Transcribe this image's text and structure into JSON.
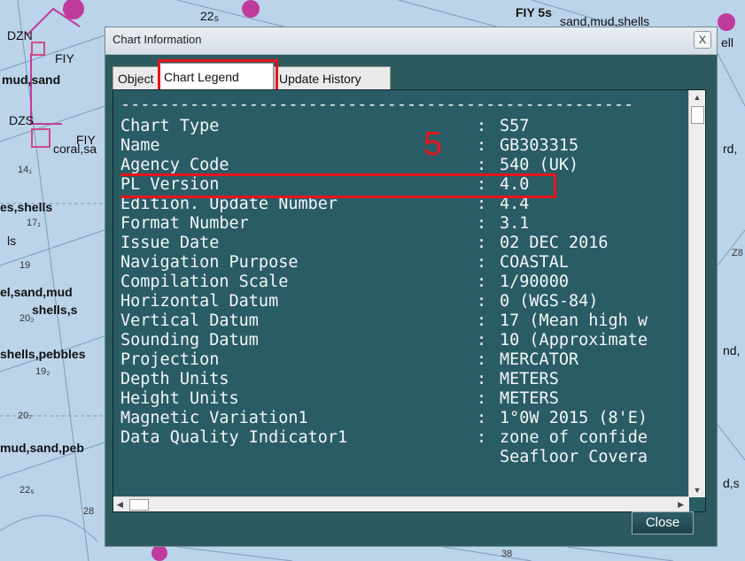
{
  "map": {
    "labels": [
      {
        "text": "DZN",
        "cls": "bold"
      },
      {
        "text": "FIY"
      },
      {
        "text": "mud,sand",
        "cls": "bold"
      },
      {
        "text": "DZS"
      },
      {
        "text": "FIY"
      },
      {
        "text": "coral,sa"
      },
      {
        "text": "es,shells",
        "cls": "bold"
      },
      {
        "text": "ls"
      },
      {
        "text": "el,sand,mud",
        "cls": "bold"
      },
      {
        "text": "shells,s",
        "cls": "bold"
      },
      {
        "text": "shells,pebbles",
        "cls": "bold"
      },
      {
        "text": "mud,sand,peb",
        "cls": "bold"
      },
      {
        "text": "FIY 5s",
        "cls": "bold"
      },
      {
        "text": "sand,mud,shells"
      },
      {
        "text": "ell"
      },
      {
        "text": "rd,"
      },
      {
        "text": "nd,"
      },
      {
        "text": "d,s"
      },
      {
        "text": "22₅"
      },
      {
        "text": "14₁",
        "cls": "small"
      },
      {
        "text": "17₁",
        "cls": "small"
      },
      {
        "text": "19",
        "cls": "small"
      },
      {
        "text": "20₂",
        "cls": "small"
      },
      {
        "text": "19₂",
        "cls": "small"
      },
      {
        "text": "20₇",
        "cls": "small"
      },
      {
        "text": "22₅",
        "cls": "small"
      },
      {
        "text": "28",
        "cls": "small"
      },
      {
        "text": "38",
        "cls": "small"
      },
      {
        "text": "Z8",
        "cls": "small"
      }
    ]
  },
  "dialog": {
    "title": "Chart Information",
    "close_glyph": "X",
    "tabs": [
      {
        "label": "Object"
      },
      {
        "label": "Chart Legend"
      },
      {
        "label": "Update History"
      }
    ],
    "dashes": "----------------------------------------------------",
    "annotation": "5",
    "rows": [
      {
        "key": "Chart Type",
        "sep": ":",
        "value": "S57"
      },
      {
        "key": "Name",
        "sep": ":",
        "value": "GB303315"
      },
      {
        "key": "Agency Code",
        "sep": ":",
        "value": "540 (UK)"
      },
      {
        "key": "PL Version",
        "sep": ":",
        "value": "4.0"
      },
      {
        "key": "Edition. Update Number",
        "sep": ":",
        "value": "4.4"
      },
      {
        "key": "Format Number",
        "sep": ":",
        "value": "3.1"
      },
      {
        "key": "Issue Date",
        "sep": ":",
        "value": "02 DEC 2016"
      },
      {
        "key": "Navigation Purpose",
        "sep": ":",
        "value": "COASTAL"
      },
      {
        "key": "Compilation Scale",
        "sep": ":",
        "value": "1/90000"
      },
      {
        "key": "Horizontal Datum",
        "sep": ":",
        "value": "0 (WGS-84)"
      },
      {
        "key": "Vertical Datum",
        "sep": ":",
        "value": "17 (Mean high w"
      },
      {
        "key": "Sounding Datum",
        "sep": ":",
        "value": "10 (Approximate"
      },
      {
        "key": "Projection",
        "sep": ":",
        "value": "MERCATOR"
      },
      {
        "key": "Depth Units",
        "sep": ":",
        "value": "METERS"
      },
      {
        "key": "Height Units",
        "sep": ":",
        "value": "METERS"
      },
      {
        "key": "Magnetic Variation1",
        "sep": ":",
        "value": "1°0W 2015 (8'E)"
      },
      {
        "key": "Data Quality Indicator1",
        "sep": ":",
        "value": "zone of confide"
      },
      {
        "key": "",
        "sep": "",
        "value": "Seafloor Covera"
      }
    ],
    "close_label": "Close",
    "arrows": {
      "up": "▲",
      "down": "▼",
      "left": "◀",
      "right": "▶"
    },
    "colors": {
      "dialog_bg": "#2d5a5e",
      "panel_bg": "#2a5c66",
      "highlight": "#e8141b",
      "text": "#f2f6f6"
    }
  }
}
